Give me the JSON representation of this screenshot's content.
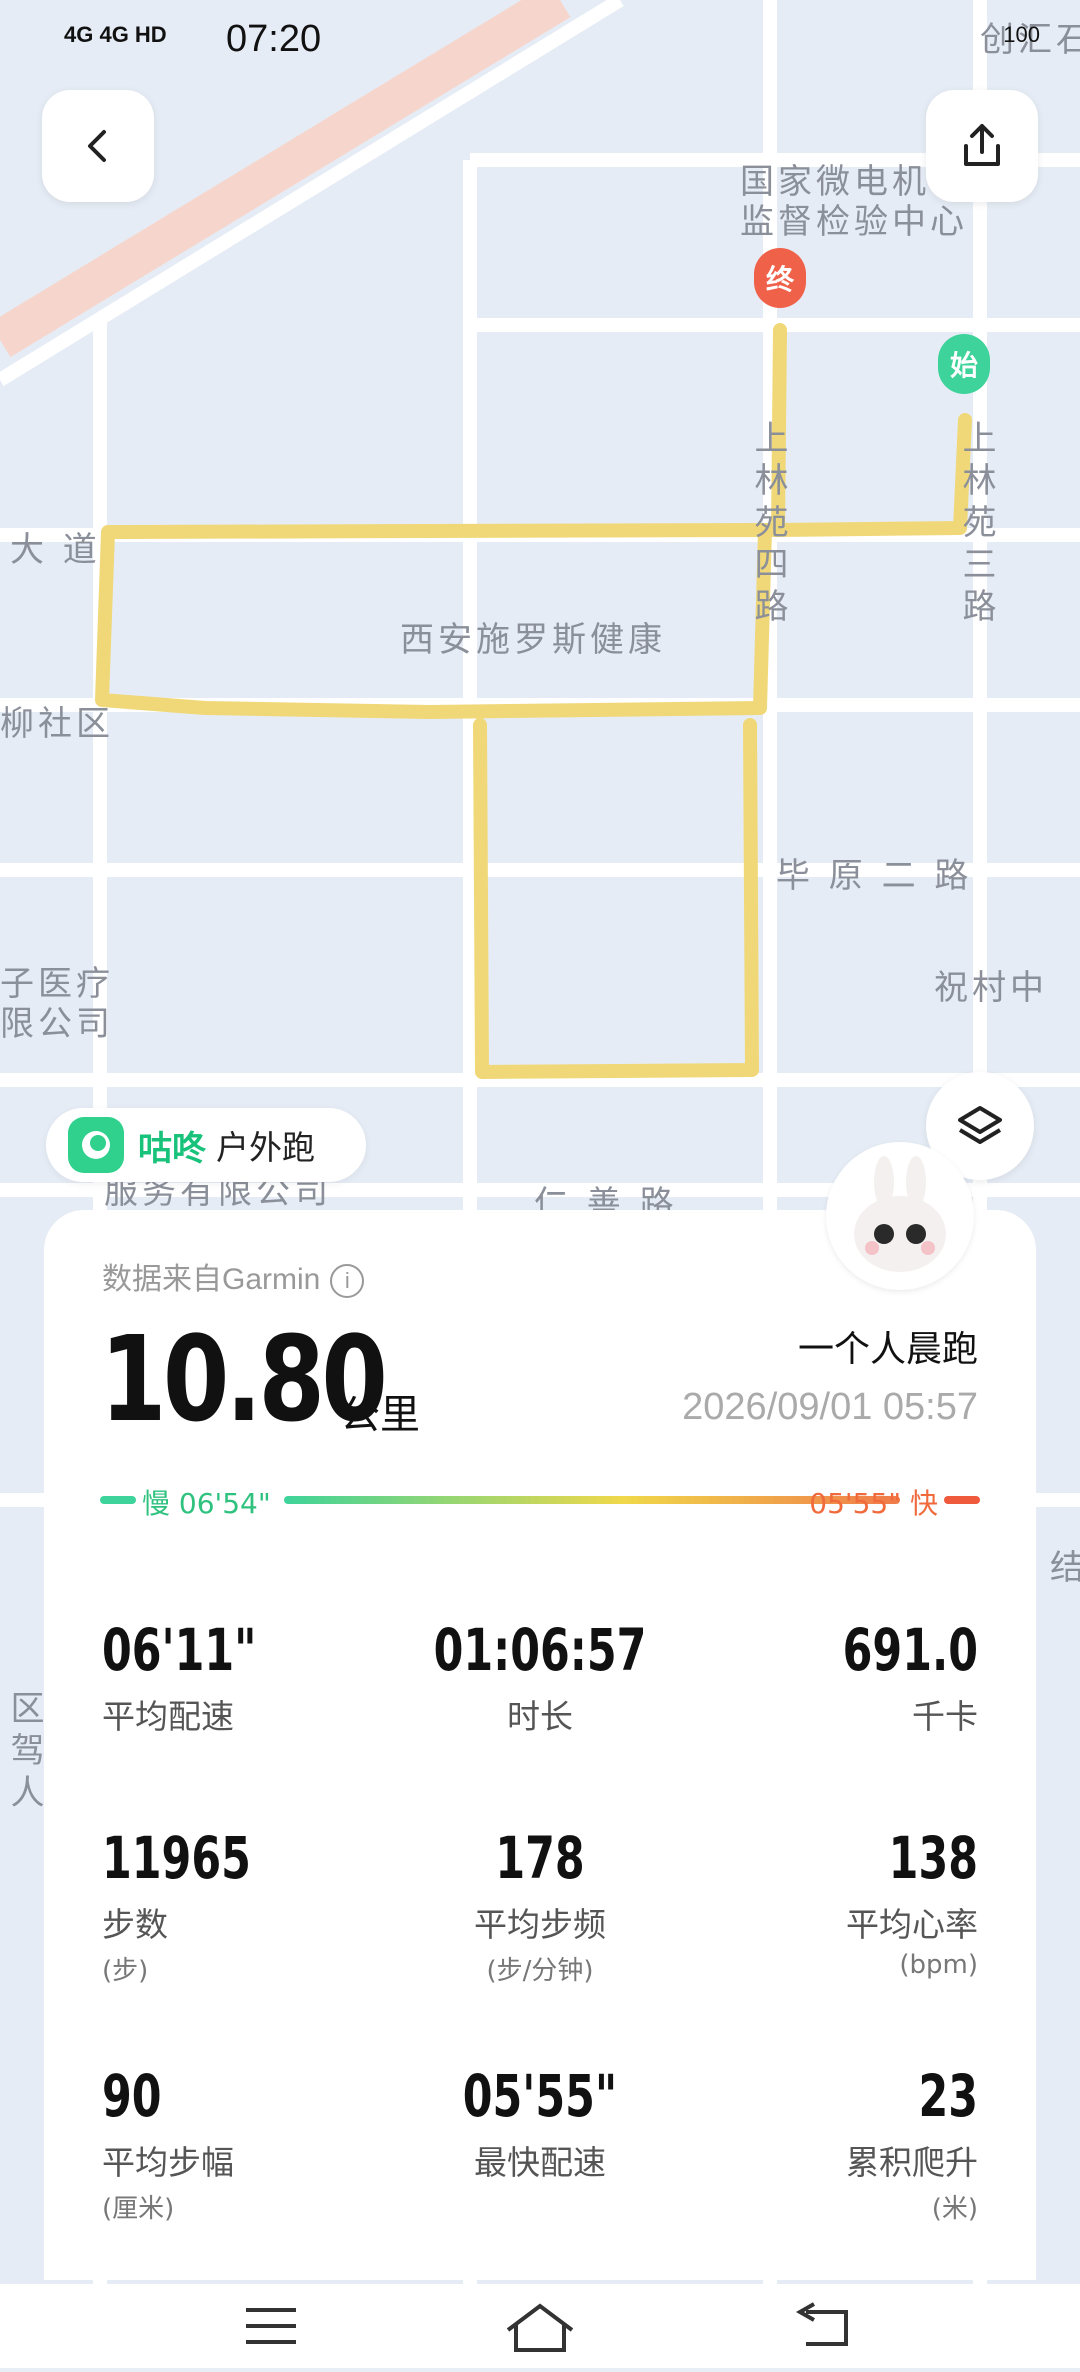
{
  "status_bar": {
    "left": "4G 4G HD",
    "time": "07:20",
    "right": "100"
  },
  "map": {
    "labels": {
      "top_right_corner": "创汇石",
      "institute": "国家微电机\n监督检验中心",
      "road_west": "大 道",
      "road_west2": "柳社区",
      "center_poi": "西安施罗斯健康",
      "road_biyuan": "毕 原 二 路",
      "road_zhucun": "祝村中",
      "company_left": "子医疗\n限公司",
      "company_bottom": "服务有限公司",
      "road_renshan": "仁 善 路",
      "road_vertical_1": "上林苑四路",
      "road_vertical_2": "上林苑三路",
      "left_area": "区驾人",
      "edge_right": "结"
    },
    "start_pin": "始",
    "end_pin": "终"
  },
  "brand": {
    "name": "咕咚",
    "type": "户外跑"
  },
  "summary": {
    "source_label": "数据来自Garmin",
    "distance": "10.80",
    "distance_unit": "公里",
    "run_title": "一个人晨跑",
    "datetime": "2026/09/01 05:57",
    "pace_slow": "慢 06'54\"",
    "pace_fast": "05'55\" 快"
  },
  "stats": [
    {
      "value": "06'11\"",
      "label": "平均配速",
      "sub": ""
    },
    {
      "value": "01:06:57",
      "label": "时长",
      "sub": ""
    },
    {
      "value": "691.0",
      "label": "千卡",
      "sub": ""
    },
    {
      "value": "11965",
      "label": "步数",
      "sub": "(步)"
    },
    {
      "value": "178",
      "label": "平均步频",
      "sub": "(步/分钟)"
    },
    {
      "value": "138",
      "label": "平均心率",
      "sub": "(bpm)"
    },
    {
      "value": "90",
      "label": "平均步幅",
      "sub": "(厘米)"
    },
    {
      "value": "05'55\"",
      "label": "最快配速",
      "sub": ""
    },
    {
      "value": "23",
      "label": "累积爬升",
      "sub": "(米)"
    }
  ],
  "colors": {
    "route": "#f0d878",
    "brand": "#18c27b",
    "end_pin": "#f0614a",
    "start_pin": "#3ed39a"
  }
}
